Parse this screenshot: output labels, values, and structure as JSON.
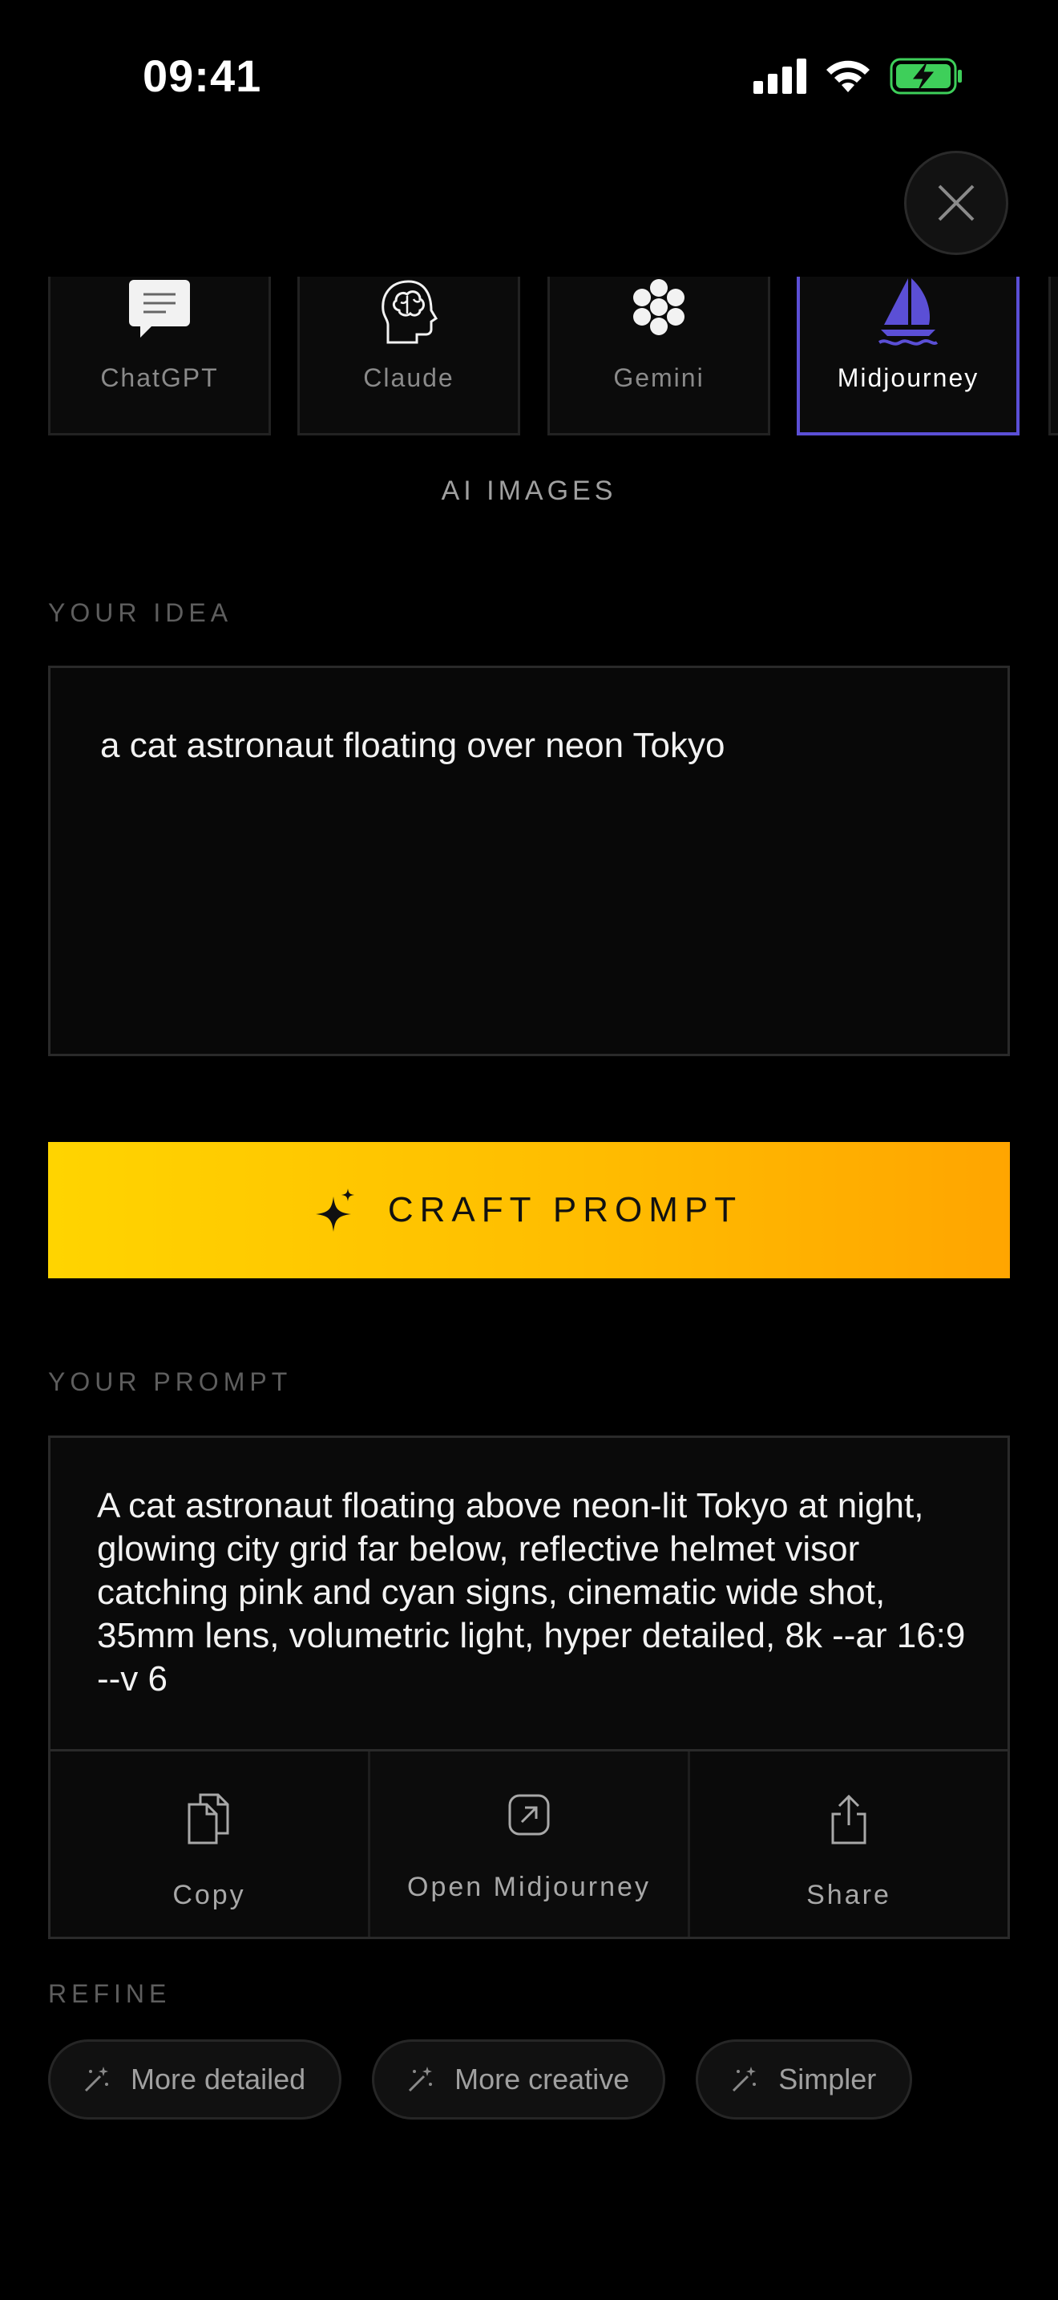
{
  "status_bar": {
    "time": "09:41",
    "icons": [
      "cellular-signal-icon",
      "wifi-icon",
      "battery-charging-icon"
    ],
    "battery_color": "#3ecf5a"
  },
  "close_icon": "close-icon",
  "models": [
    {
      "label": "ChatGPT",
      "icon": "chat-bubble-icon",
      "selected": false
    },
    {
      "label": "Claude",
      "icon": "brain-head-icon",
      "selected": false
    },
    {
      "label": "Gemini",
      "icon": "flower-dots-icon",
      "selected": false
    },
    {
      "label": "Midjourney",
      "icon": "sailboat-icon",
      "selected": true
    }
  ],
  "category_label": "AI IMAGES",
  "idea": {
    "section_label": "YOUR IDEA",
    "value": "a cat astronaut floating over neon Tokyo"
  },
  "craft_button": {
    "label": "CRAFT PROMPT",
    "icon": "sparkle-icon"
  },
  "prompt": {
    "section_label": "YOUR PROMPT",
    "text": "A cat astronaut floating above neon-lit Tokyo at night, glowing city grid far below, reflective helmet visor catching pink and cyan signs, cinematic wide shot, 35mm lens, volumetric light, hyper detailed, 8k --ar 16:9 --v 6",
    "actions": [
      {
        "label": "Copy",
        "icon": "copy-icon"
      },
      {
        "label": "Open Midjourney",
        "icon": "external-link-icon"
      },
      {
        "label": "Share",
        "icon": "share-icon"
      }
    ]
  },
  "refine": {
    "section_label": "REFINE",
    "chips": [
      {
        "label": "More detailed",
        "icon": "magic-wand-icon"
      },
      {
        "label": "More creative",
        "icon": "magic-wand-icon"
      },
      {
        "label": "Simpler",
        "icon": "magic-wand-icon"
      }
    ]
  },
  "colors": {
    "accent_selected": "#5b4fd6",
    "button_gradient_start": "#ffd400",
    "button_gradient_end": "#ffa500",
    "background": "#000000"
  }
}
